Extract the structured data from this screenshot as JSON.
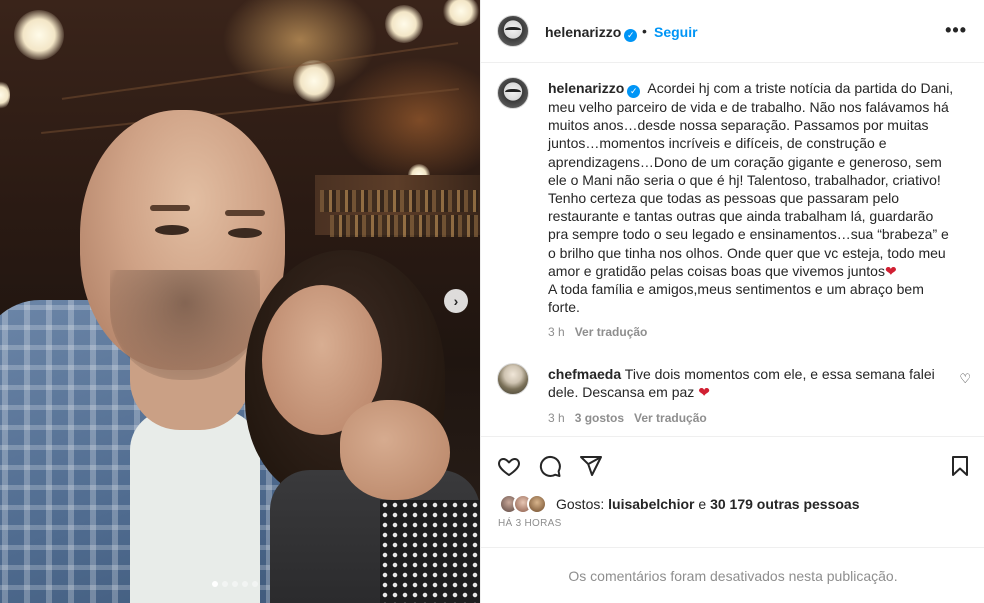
{
  "post": {
    "username": "helenarizzo",
    "verified_badge": "✓",
    "separator": "•",
    "follow_label": "Seguir",
    "more_icon": "•••",
    "caption_lines": [
      "Acordei hj com a triste notícia da partida do Dani,",
      "meu velho parceiro de vida e de trabalho. Não nos falávamos há",
      "muitos anos…desde nossa separação. Passamos por muitas",
      "juntos…momentos incríveis e difíceis, de construção e",
      "aprendizagens…Dono de um coração gigante e generoso, sem",
      "ele o Mani não seria o que é hj! Talentoso, trabalhador, criativo!",
      "Tenho certeza que todas as pessoas que passaram pelo",
      "restaurante e tantas outras que ainda trabalham lá, guardarão",
      "pra sempre todo o seu legado e ensinamentos…sua “brabeza” e",
      "o brilho que tinha nos olhos. Onde quer que vc esteja, todo meu",
      "amor e gratidão pelas coisas boas que vivemos juntos",
      "A toda família e amigos,meus sentimentos e um abraço bem",
      "forte."
    ],
    "caption_heart": "❤",
    "caption_time": "3 h",
    "caption_translate": "Ver tradução"
  },
  "comment": {
    "username": "chefmaeda",
    "lines": [
      "Tive dois momentos com ele, e essa semana falei",
      "dele. Descansa em paz"
    ],
    "heart": "❤",
    "time": "3 h",
    "likes": "3 gostos",
    "translate": "Ver tradução",
    "like_icon": "♡"
  },
  "likes": {
    "prefix": "Gostos:",
    "first_user": "luisabelchior",
    "connector": "e",
    "others": "30 179 outras pessoas",
    "timestamp": "HÁ 3 HORAS"
  },
  "footer": {
    "disabled_text": "Os comentários foram desativados nesta publicação."
  },
  "media": {
    "next_icon": "›",
    "slide_count": 5,
    "active_slide": 1
  },
  "colors": {
    "accent": "#0095f6",
    "heart": "#d11f32",
    "muted": "#8e8e8e",
    "text": "#262626"
  }
}
